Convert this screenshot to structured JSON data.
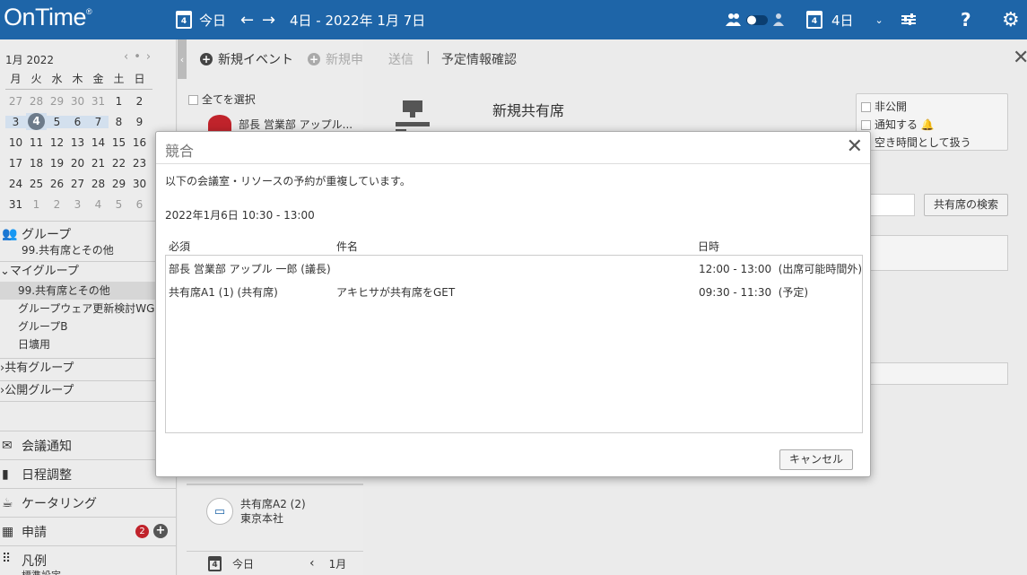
{
  "app": {
    "logo": "OnTime",
    "logo_mark": "®"
  },
  "topbar": {
    "today_icon_num": "4",
    "today_label": "今日",
    "date_range": "4日 - 2022年 1月 7日",
    "view_icon_num": "4",
    "view_label": "4日",
    "help": "?"
  },
  "mini_calendar": {
    "month": "1月 2022",
    "weekdays": [
      "月",
      "火",
      "水",
      "木",
      "金",
      "土",
      "日"
    ],
    "weeks": [
      [
        "27",
        "28",
        "29",
        "30",
        "31",
        "1",
        "2"
      ],
      [
        "3",
        "4",
        "5",
        "6",
        "7",
        "8",
        "9"
      ],
      [
        "10",
        "11",
        "12",
        "13",
        "14",
        "15",
        "16"
      ],
      [
        "17",
        "18",
        "19",
        "20",
        "21",
        "22",
        "23"
      ],
      [
        "24",
        "25",
        "26",
        "27",
        "28",
        "29",
        "30"
      ],
      [
        "31",
        "1",
        "2",
        "3",
        "4",
        "5",
        "6"
      ]
    ]
  },
  "sidebar": {
    "group_title": "グループ",
    "group_sub": "99.共有席とその他",
    "my_groups": "マイグループ",
    "my_group_items": [
      "99.共有席とその他",
      "グループウェア更新検討WG",
      "グループB",
      "日壙用"
    ],
    "shared_groups": "共有グループ",
    "public_groups": "公開グループ",
    "meeting_notice": "会議通知",
    "schedule_adjust": "日程調整",
    "catering": "ケータリング",
    "request": "申請",
    "request_badge": "2",
    "legend": "凡例",
    "legend_sub": "標準設定"
  },
  "mid": {
    "new_event": "新規イベント",
    "new_other": "新規申",
    "select_all": "全てを選択",
    "person1": "部長 営業部 アップル...",
    "resource_name": "共有席A2 (2)",
    "resource_loc": "東京本社",
    "bottom_today_num": "4",
    "bottom_today": "今日",
    "bottom_month": "1月"
  },
  "form": {
    "tab_send": "送信",
    "tab_sep": "|",
    "tab_confirm": "予定情報確認",
    "title": "新規共有席",
    "private": "非公開",
    "notify": "通知する",
    "free_time": "空き時間として扱う",
    "search_btn": "共有席の検索"
  },
  "dialog": {
    "title": "競合",
    "message": "以下の会議室・リソースの予約が重複しています。",
    "datetime": "2022年1月6日 10:30 - 13:00",
    "columns": {
      "required": "必須",
      "subject": "件名",
      "time": "日時"
    },
    "rows": [
      {
        "required": "部長 営業部 アップル 一郎 (議長)",
        "subject": "",
        "time": "12:00 - 13:00  (出席可能時間外)"
      },
      {
        "required": "共有席A1 (1) (共有席)",
        "subject": "アキヒサが共有席をGET",
        "time": "09:30 - 11:30  (予定)"
      }
    ],
    "cancel": "キャンセル"
  },
  "colors": {
    "topbar": "#1e65a8",
    "badge": "#c0232b",
    "today_circle": "#6d7b8a"
  }
}
